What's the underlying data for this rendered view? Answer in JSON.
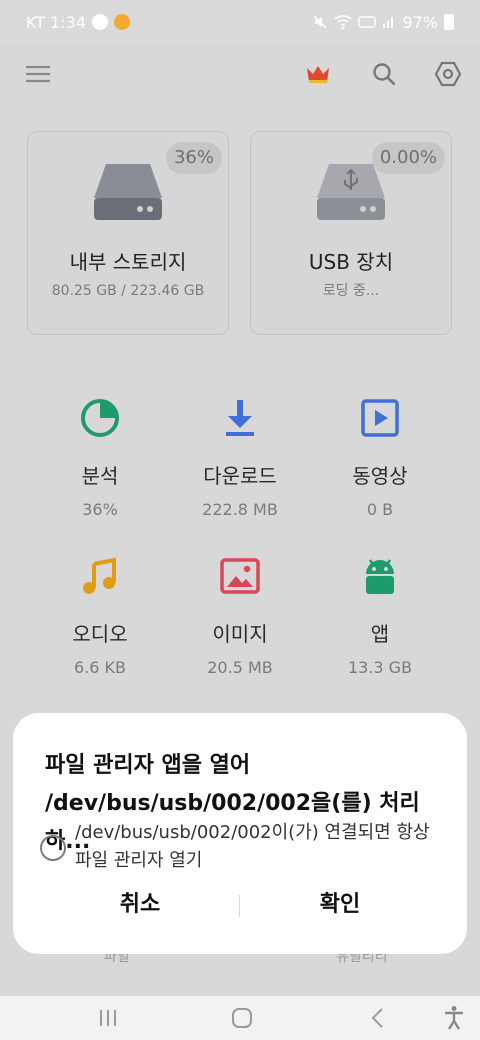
{
  "status_bar": {
    "carrier_time": "KT 1:34",
    "battery": "97%"
  },
  "storage": {
    "internal": {
      "percent": "36%",
      "title": "내부 스토리지",
      "subtitle": "80.25 GB / 223.46 GB"
    },
    "usb": {
      "percent": "0.00%",
      "title": "USB 장치",
      "subtitle": "로딩 중..."
    }
  },
  "categories": [
    {
      "label": "분석",
      "size": "36%",
      "icon": "analysis-pie-icon",
      "color": "#1e9b6c"
    },
    {
      "label": "다운로드",
      "size": "222.8 MB",
      "icon": "download-icon",
      "color": "#3f6fd8"
    },
    {
      "label": "동영상",
      "size": "0 B",
      "icon": "video-icon",
      "color": "#3f6fd8"
    },
    {
      "label": "오디오",
      "size": "6.6 KB",
      "icon": "music-note-icon",
      "color": "#e39b12"
    },
    {
      "label": "이미지",
      "size": "20.5 MB",
      "icon": "image-icon",
      "color": "#d8465a"
    },
    {
      "label": "앱",
      "size": "13.3 GB",
      "icon": "android-icon",
      "color": "#1e9b6c"
    }
  ],
  "bottom_nav": {
    "files": "파일",
    "utilities": "유틸리티"
  },
  "dialog": {
    "title": "파일 관리자 앱을 열어 /dev/bus/usb/002/002을(를) 처리하...",
    "checkbox_label": "/dev/bus/usb/002/002이(가) 연결되면 항상 파일 관리자 열기",
    "cancel": "취소",
    "confirm": "확인"
  }
}
